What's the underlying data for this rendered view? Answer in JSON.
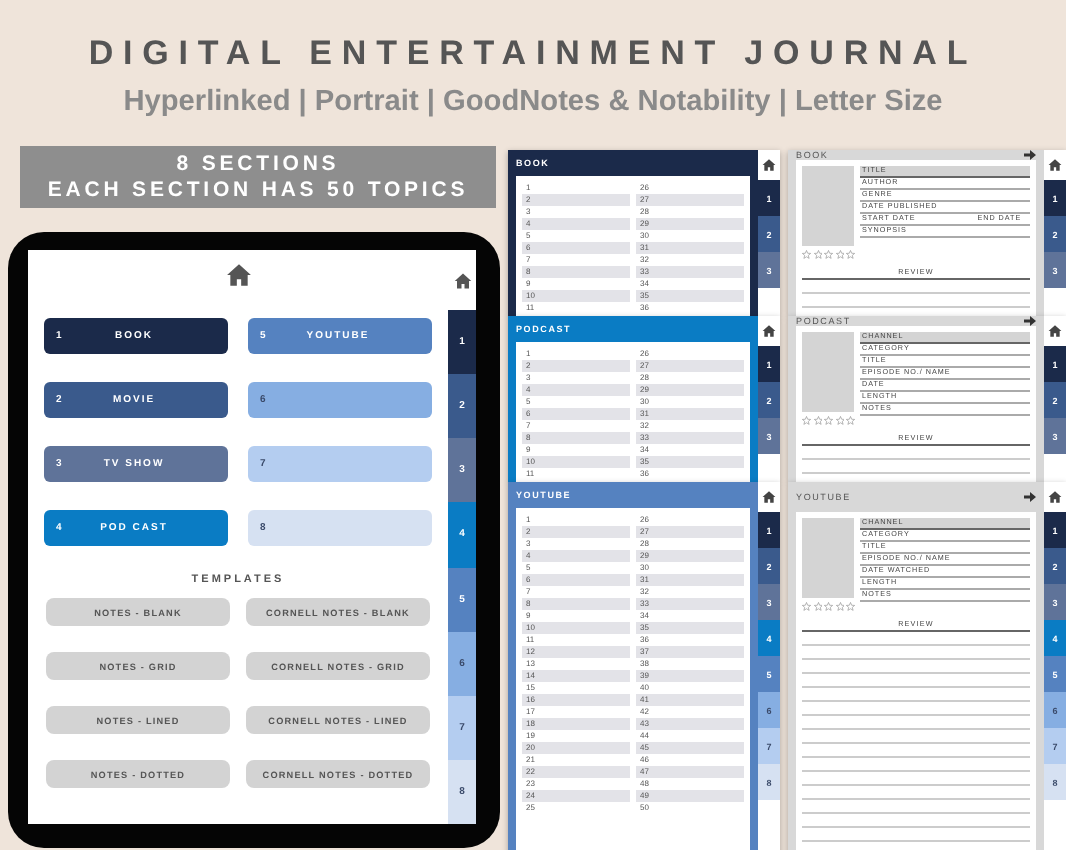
{
  "title": "DIGITAL ENTERTAINMENT JOURNAL",
  "subtitle": "Hyperlinked | Portrait | GoodNotes & Notability | Letter Size",
  "banner": [
    "8 SECTIONS",
    "EACH SECTION HAS 50 TOPICS"
  ],
  "tablet": {
    "sections": [
      {
        "number": "1",
        "label": "BOOK",
        "color": "#1b2a4a"
      },
      {
        "number": "5",
        "label": "YOUTUBE",
        "color": "#5582c0"
      },
      {
        "number": "2",
        "label": "MOVIE",
        "color": "#3a5a8c"
      },
      {
        "number": "6",
        "color": "#86aee2"
      },
      {
        "number": "3",
        "label": "TV SHOW",
        "color": "#5f7399"
      },
      {
        "number": "7",
        "color": "#b4cdf0"
      },
      {
        "number": "4",
        "label": "POD CAST",
        "color": "#0a7cc4"
      },
      {
        "number": "8",
        "color": "#d6e1f2"
      }
    ],
    "templates_heading": "TEMPLATES",
    "templates": [
      "NOTES - BLANK",
      "CORNELL NOTES - BLANK",
      "NOTES - GRID",
      "CORNELL NOTES - GRID",
      "NOTES - LINED",
      "CORNELL NOTES - LINED",
      "NOTES - DOTTED",
      "CORNELL NOTES - DOTTED"
    ],
    "tabs": [
      {
        "label": "1",
        "color": "#1b2a4a"
      },
      {
        "label": "2",
        "color": "#3a5a8c"
      },
      {
        "label": "3",
        "color": "#5f7399"
      },
      {
        "label": "4",
        "color": "#0a7cc4"
      },
      {
        "label": "5",
        "color": "#5582c0"
      },
      {
        "label": "6",
        "color": "#86aee2"
      },
      {
        "label": "7",
        "color": "#b4cdf0"
      },
      {
        "label": "8",
        "color": "#d6e1f2"
      }
    ]
  },
  "index_pages": [
    {
      "title": "BOOK",
      "color": "#1b2a4a",
      "rows": [
        [
          "1",
          "26"
        ],
        [
          "2",
          "27"
        ],
        [
          "3",
          "28"
        ],
        [
          "4",
          "29"
        ],
        [
          "5",
          "30"
        ],
        [
          "6",
          "31"
        ],
        [
          "7",
          "32"
        ],
        [
          "8",
          "33"
        ],
        [
          "9",
          "34"
        ],
        [
          "10",
          "35"
        ],
        [
          "11",
          "36"
        ]
      ],
      "tabs": [
        {
          "label": "1",
          "color": "#1b2a4a"
        },
        {
          "label": "2",
          "color": "#3a5a8c"
        },
        {
          "label": "3",
          "color": "#5f7399"
        }
      ]
    },
    {
      "title": "PODCAST",
      "color": "#0a7cc4",
      "rows": [
        [
          "1",
          "26"
        ],
        [
          "2",
          "27"
        ],
        [
          "3",
          "28"
        ],
        [
          "4",
          "29"
        ],
        [
          "5",
          "30"
        ],
        [
          "6",
          "31"
        ],
        [
          "7",
          "32"
        ],
        [
          "8",
          "33"
        ],
        [
          "9",
          "34"
        ],
        [
          "10",
          "35"
        ],
        [
          "11",
          "36"
        ]
      ],
      "tabs": [
        {
          "label": "1",
          "color": "#1b2a4a"
        },
        {
          "label": "2",
          "color": "#3a5a8c"
        },
        {
          "label": "3",
          "color": "#5f7399"
        }
      ]
    },
    {
      "title": "YOUTUBE",
      "color": "#5582c0",
      "rows": [
        [
          "1",
          "26"
        ],
        [
          "2",
          "27"
        ],
        [
          "3",
          "28"
        ],
        [
          "4",
          "29"
        ],
        [
          "5",
          "30"
        ],
        [
          "6",
          "31"
        ],
        [
          "7",
          "32"
        ],
        [
          "8",
          "33"
        ],
        [
          "9",
          "34"
        ],
        [
          "10",
          "35"
        ],
        [
          "11",
          "36"
        ],
        [
          "12",
          "37"
        ],
        [
          "13",
          "38"
        ],
        [
          "14",
          "39"
        ],
        [
          "15",
          "40"
        ],
        [
          "16",
          "41"
        ],
        [
          "17",
          "42"
        ],
        [
          "18",
          "43"
        ],
        [
          "19",
          "44"
        ],
        [
          "20",
          "45"
        ],
        [
          "21",
          "46"
        ],
        [
          "22",
          "47"
        ],
        [
          "23",
          "48"
        ],
        [
          "24",
          "49"
        ],
        [
          "25",
          "50"
        ]
      ],
      "tabs": [
        {
          "label": "1",
          "color": "#1b2a4a"
        },
        {
          "label": "2",
          "color": "#3a5a8c"
        },
        {
          "label": "3",
          "color": "#5f7399"
        },
        {
          "label": "4",
          "color": "#0a7cc4"
        },
        {
          "label": "5",
          "color": "#5582c0"
        },
        {
          "label": "6",
          "color": "#86aee2"
        },
        {
          "label": "7",
          "color": "#b4cdf0"
        },
        {
          "label": "8",
          "color": "#d6e1f2"
        }
      ]
    }
  ],
  "review_pages": [
    {
      "title": "BOOK",
      "stars": 0,
      "fields": [
        [
          "TITLE"
        ],
        [
          "AUTHOR"
        ],
        [
          "GENRE"
        ],
        [
          "DATE PUBLISHED"
        ],
        [
          "START DATE",
          "END DATE"
        ],
        [
          "SYNOPSIS"
        ]
      ],
      "review_label": "REVIEW",
      "tabs": [
        {
          "label": "1",
          "color": "#1b2a4a"
        },
        {
          "label": "2",
          "color": "#3a5a8c"
        },
        {
          "label": "3",
          "color": "#5f7399"
        }
      ]
    },
    {
      "title": "PODCAST",
      "stars": 0,
      "fields": [
        [
          "CHANNEL"
        ],
        [
          "CATEGORY"
        ],
        [
          "TITLE"
        ],
        [
          "EPISODE NO./ NAME"
        ],
        [
          "DATE"
        ],
        [
          "LENGTH"
        ],
        [
          "NOTES"
        ]
      ],
      "review_label": "REVIEW",
      "tabs": [
        {
          "label": "1",
          "color": "#1b2a4a"
        },
        {
          "label": "2",
          "color": "#3a5a8c"
        },
        {
          "label": "3",
          "color": "#5f7399"
        }
      ]
    },
    {
      "title": "YOUTUBE",
      "stars": 0,
      "fields": [
        [
          "CHANNEL"
        ],
        [
          "CATEGORY"
        ],
        [
          "TITLE"
        ],
        [
          "EPISODE NO./ NAME"
        ],
        [
          "DATE WATCHED"
        ],
        [
          "LENGTH"
        ],
        [
          "NOTES"
        ]
      ],
      "review_label": "REVIEW",
      "tabs": [
        {
          "label": "1",
          "color": "#1b2a4a"
        },
        {
          "label": "2",
          "color": "#3a5a8c"
        },
        {
          "label": "3",
          "color": "#5f7399"
        },
        {
          "label": "4",
          "color": "#0a7cc4"
        },
        {
          "label": "5",
          "color": "#5582c0"
        },
        {
          "label": "6",
          "color": "#86aee2"
        },
        {
          "label": "7",
          "color": "#b4cdf0"
        },
        {
          "label": "8",
          "color": "#d6e1f2"
        }
      ]
    }
  ]
}
